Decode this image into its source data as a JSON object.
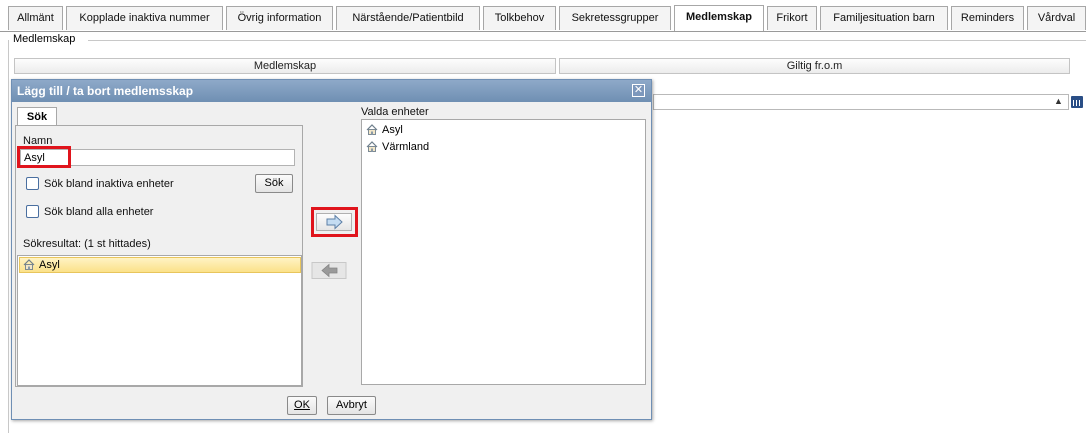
{
  "tabs": [
    {
      "label": "Allmänt"
    },
    {
      "label": "Kopplade inaktiva nummer"
    },
    {
      "label": "Övrig information"
    },
    {
      "label": "Närstående/Patientbild"
    },
    {
      "label": "Tolkbehov"
    },
    {
      "label": "Sekretessgrupper"
    },
    {
      "label": "Medlemskap"
    },
    {
      "label": "Frikort"
    },
    {
      "label": "Familjesituation barn"
    },
    {
      "label": "Reminders"
    },
    {
      "label": "Vårdval"
    }
  ],
  "active_tab": "Medlemskap",
  "group": {
    "legend": "Medlemskap",
    "columns": [
      "Medlemskap",
      "Giltig fr.o.m"
    ]
  },
  "dialog": {
    "title": "Lägg till / ta bort medlemsskap",
    "subtab": "Sök",
    "name_label": "Namn",
    "name_value": "Asyl",
    "checkbox_inactive": "Sök bland inaktiva enheter",
    "checkbox_all": "Sök bland alla enheter",
    "search_button": "Sök",
    "results_label": "Sökresultat: (1 st hittades)",
    "results": [
      "Asyl"
    ],
    "selected_label": "Valda enheter",
    "selected": [
      "Asyl",
      "Värmland"
    ],
    "ok_button": "OK",
    "cancel_button": "Avbryt"
  },
  "icons": {
    "add": "arrow-right-icon",
    "remove": "arrow-left-icon",
    "unit": "house-icon",
    "close": "close-icon",
    "calendar": "calendar-icon"
  },
  "colors": {
    "titlebar": "#7f9bbf",
    "highlight": "#e0141c",
    "selected_row": "#fbe18a"
  }
}
